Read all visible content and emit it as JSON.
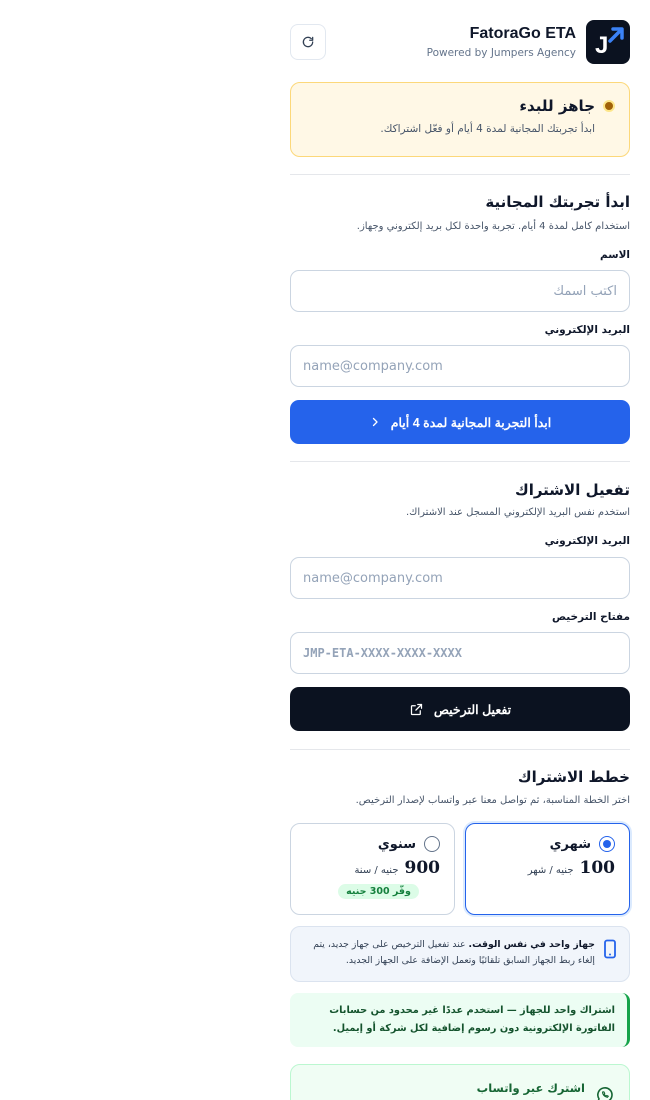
{
  "header": {
    "title": "FatoraGo ETA",
    "subtitle": "Powered by Jumpers Agency",
    "logo_letter": "J"
  },
  "status": {
    "title": "جاهز للبدء",
    "subtitle": "ابدأ تجربتك المجانية لمدة 4 أيام أو فعّل اشتراكك."
  },
  "trial": {
    "title": "ابدأ تجربتك المجانية",
    "subtitle": "استخدام كامل لمدة 4 أيام. تجربة واحدة لكل بريد إلكتروني وجهاز.",
    "name_label": "الاسم",
    "name_placeholder": "اكتب اسمك",
    "email_label": "البريد الإلكتروني",
    "email_placeholder": "name@company.com",
    "button_label": "ابدأ التجربة المجانية لمدة 4 أيام"
  },
  "activation": {
    "title": "تفعيل الاشتراك",
    "subtitle": "استخدم نفس البريد الإلكتروني المسجل عند الاشتراك.",
    "email_label": "البريد الإلكتروني",
    "email_placeholder": "name@company.com",
    "key_label": "مفتاح الترخيص",
    "key_placeholder": "JMP-ETA-XXXX-XXXX-XXXX",
    "button_label": "تفعيل الترخيص"
  },
  "plans": {
    "title": "خطط الاشتراك",
    "subtitle": "اختر الخطة المناسبة، ثم تواصل معنا عبر واتساب لإصدار الترخيص.",
    "monthly": {
      "name": "شهري",
      "price": "100",
      "unit": "جنيه / شهر",
      "selected": true
    },
    "yearly": {
      "name": "سنوي",
      "price": "900",
      "unit": "جنيه / سنة",
      "badge": "وفّر 300 جنيه",
      "selected": false
    }
  },
  "device_note": {
    "bold": "جهاز واحد في نفس الوقت.",
    "text": " عند تفعيل الترخيص على جهاز جديد، يتم إلغاء ربط الجهاز السابق تلقائيًا وتعمل الإضافة على الجهاز الجديد."
  },
  "green_note": {
    "text": "اشتراك واحد للجهاز — استخدم عددًا غير محدود من حسابات الفاتورة الإلكترونية دون رسوم إضافية لكل شركة أو إيميل."
  },
  "whatsapp": {
    "title": "اشترك عبر واتساب"
  },
  "colors": {
    "accent": "#2563eb",
    "dark": "#0b1220",
    "warning_bg": "#fff8e6",
    "success": "#16a34a"
  }
}
